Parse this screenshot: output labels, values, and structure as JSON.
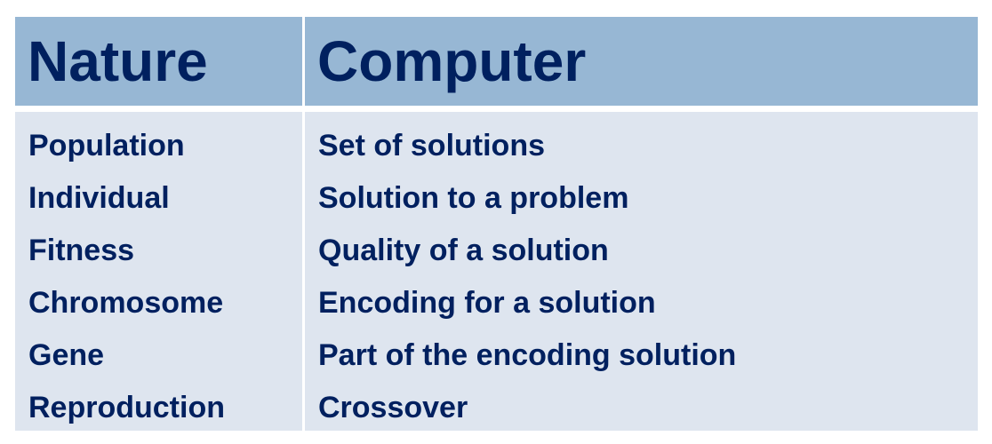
{
  "table": {
    "headers": [
      "Nature",
      "Computer"
    ],
    "rows": [
      {
        "nature": "Population",
        "computer": "Set of solutions"
      },
      {
        "nature": "Individual",
        "computer": "Solution to a problem"
      },
      {
        "nature": "Fitness",
        "computer": "Quality of a solution"
      },
      {
        "nature": "Chromosome",
        "computer": "Encoding for a solution"
      },
      {
        "nature": "Gene",
        "computer": "Part of the encoding solution"
      },
      {
        "nature": "Reproduction",
        "computer": "Crossover"
      }
    ]
  },
  "colors": {
    "header_bg": "#97b7d4",
    "body_bg": "#dee5ef",
    "text": "#00205f"
  }
}
